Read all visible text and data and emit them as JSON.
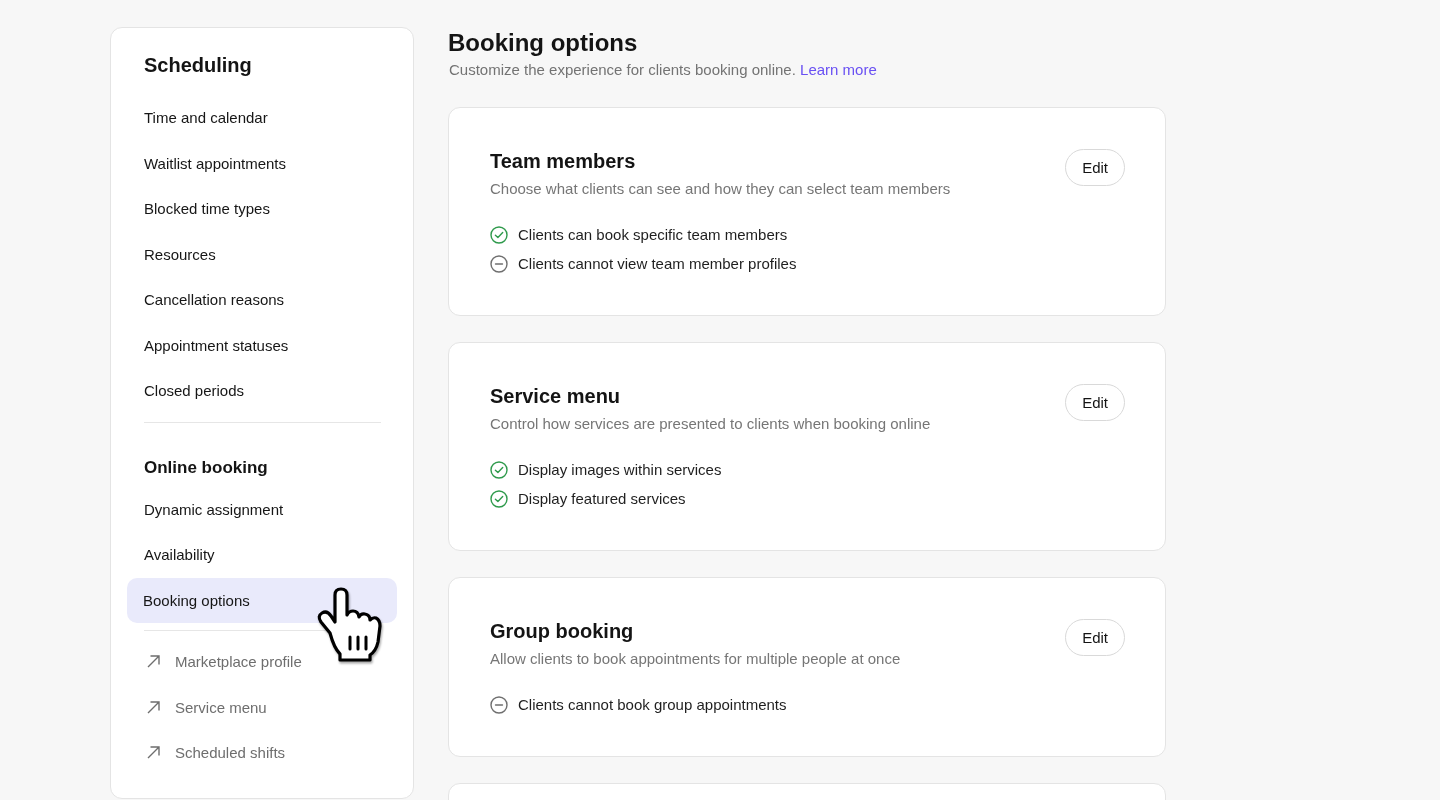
{
  "sidebar": {
    "sections": [
      {
        "title": "Scheduling",
        "items": [
          {
            "label": "Time and calendar",
            "selected": false
          },
          {
            "label": "Waitlist appointments",
            "selected": false
          },
          {
            "label": "Blocked time types",
            "selected": false
          },
          {
            "label": "Resources",
            "selected": false
          },
          {
            "label": "Cancellation reasons",
            "selected": false
          },
          {
            "label": "Appointment statuses",
            "selected": false
          },
          {
            "label": "Closed periods",
            "selected": false
          }
        ]
      },
      {
        "title": "Online booking",
        "items": [
          {
            "label": "Dynamic assignment",
            "selected": false
          },
          {
            "label": "Availability",
            "selected": false
          },
          {
            "label": "Booking options",
            "selected": true
          }
        ]
      }
    ],
    "external_links": [
      "Marketplace profile",
      "Service menu",
      "Scheduled shifts"
    ]
  },
  "header": {
    "title": "Booking options",
    "subtitle": "Customize the experience for clients booking online.",
    "link": "Learn more"
  },
  "cards": [
    {
      "kind": "settings",
      "title": "Team members",
      "description": "Choose what clients can see and how they can select team members",
      "button": "Edit",
      "features": [
        {
          "text": "Clients can book specific team members",
          "enabled": true
        },
        {
          "text": "Clients cannot view team member profiles",
          "enabled": false
        }
      ]
    },
    {
      "kind": "settings",
      "title": "Service menu",
      "description": "Control how services are presented to clients when booking online",
      "button": "Edit",
      "features": [
        {
          "text": "Display images within services",
          "enabled": true
        },
        {
          "text": "Display featured services",
          "enabled": true
        }
      ]
    },
    {
      "kind": "settings",
      "title": "Group booking",
      "description": "Allow clients to book appointments for multiple people at once",
      "button": "Edit",
      "features": [
        {
          "text": "Clients cannot book group appointments",
          "enabled": false
        }
      ]
    },
    {
      "kind": "cut-off"
    }
  ]
}
